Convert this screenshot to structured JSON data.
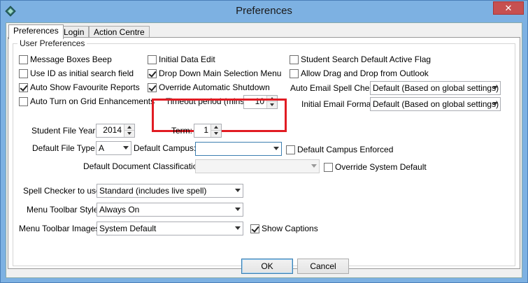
{
  "window": {
    "title": "Preferences",
    "close_glyph": "✕"
  },
  "tabs": [
    "Preferences",
    "Login",
    "Action Centre"
  ],
  "group_label": "User Preferences",
  "checkboxes": {
    "message_boxes_beep": {
      "label": "Message Boxes Beep",
      "checked": false
    },
    "use_id_search": {
      "label": "Use ID as initial search field",
      "checked": false
    },
    "auto_show_fav": {
      "label": "Auto Show Favourite Reports",
      "checked": true
    },
    "auto_turn_grid": {
      "label": "Auto Turn on Grid Enhancements",
      "checked": false
    },
    "initial_data_edit": {
      "label": "Initial Data Edit",
      "checked": false
    },
    "drop_down_menu": {
      "label": "Drop Down Main Selection Menu",
      "checked": true
    },
    "override_shutdown": {
      "label": "Override Automatic Shutdown",
      "checked": true
    },
    "student_search_flag": {
      "label": "Student Search Default Active Flag",
      "checked": false
    },
    "allow_drag_drop": {
      "label": "Allow Drag and Drop from Outlook",
      "checked": false
    },
    "default_campus_enforced": {
      "label": "Default Campus Enforced",
      "checked": false
    },
    "override_system_default": {
      "label": "Override System Default",
      "checked": false
    },
    "show_captions": {
      "label": "Show Captions",
      "checked": true
    }
  },
  "timeout": {
    "label": "Timeout period (mins):",
    "value": "10"
  },
  "auto_email_spell": {
    "label": "Auto Email Spell Check:",
    "value": "Default (Based on global settings)"
  },
  "initial_email_format": {
    "label": "Initial Email Format:",
    "value": "Default (Based on global settings)"
  },
  "student_file_year": {
    "label": "Student File Year:",
    "value": "2014"
  },
  "term": {
    "label": "Term:",
    "value": "1"
  },
  "default_file_type": {
    "label": "Default File Type:",
    "value": "A"
  },
  "default_campus": {
    "label": "Default Campus:",
    "value": ""
  },
  "default_doc_class": {
    "label": "Default Document Classification:",
    "value": ""
  },
  "spell_checker": {
    "label": "Spell Checker to use:",
    "value": "Standard (includes live spell)"
  },
  "menu_toolbar_style": {
    "label": "Menu Toolbar Style:",
    "value": "Always On"
  },
  "menu_toolbar_images": {
    "label": "Menu Toolbar Images:",
    "value": "System Default"
  },
  "buttons": {
    "ok": "OK",
    "cancel": "Cancel"
  }
}
